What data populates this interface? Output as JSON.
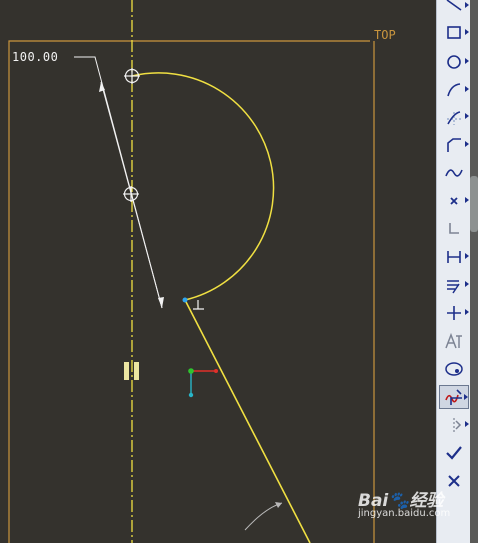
{
  "canvas": {
    "dimension_value": "100.00",
    "view_label": "TOP",
    "colors": {
      "background": "#34322d",
      "frame": "#c9953e",
      "centerline": "#f0e042",
      "arc": "#f0e042",
      "dimension": "#f2f2f2",
      "axis_x": "#e0302a",
      "axis_y": "#2fc42f",
      "axis_z": "#28b5c8"
    }
  },
  "toolbar": {
    "tools": [
      {
        "name": "line-tool",
        "icon": "line-icon",
        "has_menu": true
      },
      {
        "name": "rectangle-tool",
        "icon": "rectangle-icon",
        "has_menu": true
      },
      {
        "name": "circle-tool",
        "icon": "circle-icon",
        "has_menu": true
      },
      {
        "name": "arc-tool",
        "icon": "arc-icon",
        "has_menu": true
      },
      {
        "name": "fillet-tool",
        "icon": "fillet-icon",
        "has_menu": true
      },
      {
        "name": "chamfer-tool",
        "icon": "chamfer-icon",
        "has_menu": true
      },
      {
        "name": "spline-tool",
        "icon": "spline-icon",
        "has_menu": false
      },
      {
        "name": "point-tool",
        "icon": "point-icon",
        "has_menu": true
      },
      {
        "name": "coordinate-tool",
        "icon": "coordinate-icon",
        "has_menu": false
      },
      {
        "name": "dimension-tool",
        "icon": "dimension-icon",
        "has_menu": true
      },
      {
        "name": "modify-tool",
        "icon": "modify-icon",
        "has_menu": true
      },
      {
        "name": "constraint-tool",
        "icon": "constraint-icon",
        "has_menu": true
      },
      {
        "name": "text-tool",
        "icon": "text-icon",
        "has_menu": false
      },
      {
        "name": "palette-tool",
        "icon": "palette-icon",
        "has_menu": false
      },
      {
        "name": "trim-tool",
        "icon": "trim-icon",
        "has_menu": true,
        "active": true
      },
      {
        "name": "mirror-tool",
        "icon": "mirror-icon",
        "has_menu": true
      },
      {
        "name": "accept-tool",
        "icon": "checkmark-icon",
        "has_menu": false
      },
      {
        "name": "cancel-tool",
        "icon": "close-icon",
        "has_menu": false
      }
    ]
  },
  "watermark": {
    "brand": "Bai",
    "brand_suffix": "经验",
    "url": "jingyan.baidu.com"
  }
}
